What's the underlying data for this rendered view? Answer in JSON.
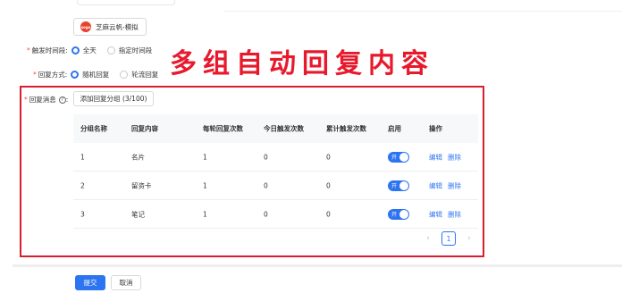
{
  "account": {
    "logo_text": "sogo",
    "name": "芝麻云帆-模拟"
  },
  "trigger_time": {
    "label": "触发时间段:",
    "options": [
      {
        "label": "全天",
        "checked": true
      },
      {
        "label": "指定时间段",
        "checked": false
      }
    ]
  },
  "reply_mode": {
    "label": "回复方式:",
    "options": [
      {
        "label": "随机回复",
        "checked": true
      },
      {
        "label": "轮流回复",
        "checked": false
      }
    ]
  },
  "overlay_text": "多组自动回复内容",
  "reply_message": {
    "label": "回复消息",
    "help_icon": "?",
    "add_button": "添加回复分组 (3/100)"
  },
  "table": {
    "headers": [
      "分组名称",
      "回复内容",
      "每轮回复次数",
      "今日触发次数",
      "累计触发次数",
      "启用",
      "操作"
    ],
    "rows": [
      {
        "name": "1",
        "content": "名片",
        "per_round": "1",
        "today": "0",
        "total": "0",
        "enabled": "开",
        "edit": "编辑",
        "delete": "删除"
      },
      {
        "name": "2",
        "content": "留资卡",
        "per_round": "1",
        "today": "0",
        "total": "0",
        "enabled": "开",
        "edit": "编辑",
        "delete": "删除"
      },
      {
        "name": "3",
        "content": "笔记",
        "per_round": "1",
        "today": "0",
        "total": "0",
        "enabled": "开",
        "edit": "编辑",
        "delete": "删除"
      }
    ]
  },
  "pagination": {
    "prev": "‹",
    "page": "1",
    "next": "›"
  },
  "actions": {
    "submit": "提交",
    "cancel": "取消"
  },
  "colors": {
    "primary": "#2c74f0",
    "highlight": "#d81e2e",
    "required": "#ff4d4f"
  }
}
